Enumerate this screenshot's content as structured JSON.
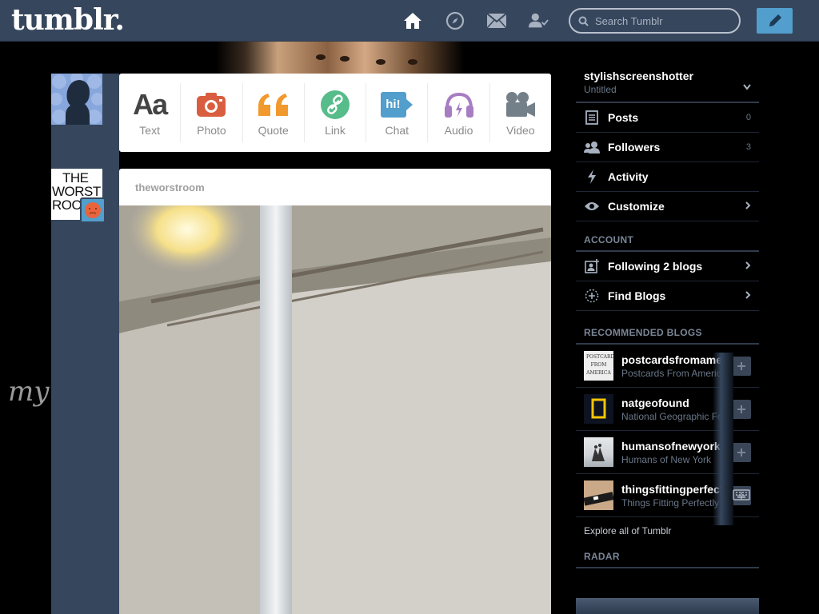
{
  "topbar": {
    "logo": "tumblr.",
    "search_placeholder": "Search Tumblr",
    "icons": [
      "home-icon",
      "compass-icon",
      "mail-icon",
      "account-icon",
      "compose-icon"
    ]
  },
  "background": {
    "handwriting": "my"
  },
  "post_types": [
    {
      "label": "Text",
      "glyph": "Aa",
      "color": "#444444"
    },
    {
      "label": "Photo",
      "glyph": "",
      "color": "#d95e40"
    },
    {
      "label": "Quote",
      "glyph": "“",
      "color": "#f2992e"
    },
    {
      "label": "Link",
      "glyph": "",
      "color": "#56bc8a"
    },
    {
      "label": "Chat",
      "glyph": "hi!",
      "color": "#529ecc"
    },
    {
      "label": "Audio",
      "glyph": "",
      "color": "#a77dc2"
    },
    {
      "label": "Video",
      "glyph": "",
      "color": "#748089"
    }
  ],
  "post": {
    "blog_name": "theworstroom",
    "avatar_text": [
      "THE",
      "WORST",
      "ROO"
    ]
  },
  "sidebar": {
    "blog_name": "stylishscreenshotter",
    "blog_subtitle": "Untitled",
    "menu": [
      {
        "label": "Posts",
        "count": "0"
      },
      {
        "label": "Followers",
        "count": "3"
      },
      {
        "label": "Activity",
        "count": ""
      },
      {
        "label": "Customize",
        "count": ""
      }
    ],
    "account_title": "ACCOUNT",
    "account_items": [
      {
        "label": "Following 2 blogs"
      },
      {
        "label": "Find Blogs"
      }
    ],
    "recommended_title": "RECOMMENDED BLOGS",
    "recommended": [
      {
        "name": "postcardsfromamerica",
        "desc": "Postcards From America",
        "thumb_text": "POSTCARDS FROM AMERICA"
      },
      {
        "name": "natgeofound",
        "desc": "National Geographic Found",
        "thumb_text": ""
      },
      {
        "name": "humansofnewyork",
        "desc": "Humans of New York",
        "thumb_text": ""
      },
      {
        "name": "thingsfittingperfectly",
        "desc": "Things Fitting Perfectly",
        "thumb_text": ""
      }
    ],
    "explore": "Explore all of Tumblr",
    "radar_title": "RADAR"
  },
  "colors": {
    "topbar": "#36465d",
    "accent": "#529ecc",
    "background": "#000000"
  }
}
